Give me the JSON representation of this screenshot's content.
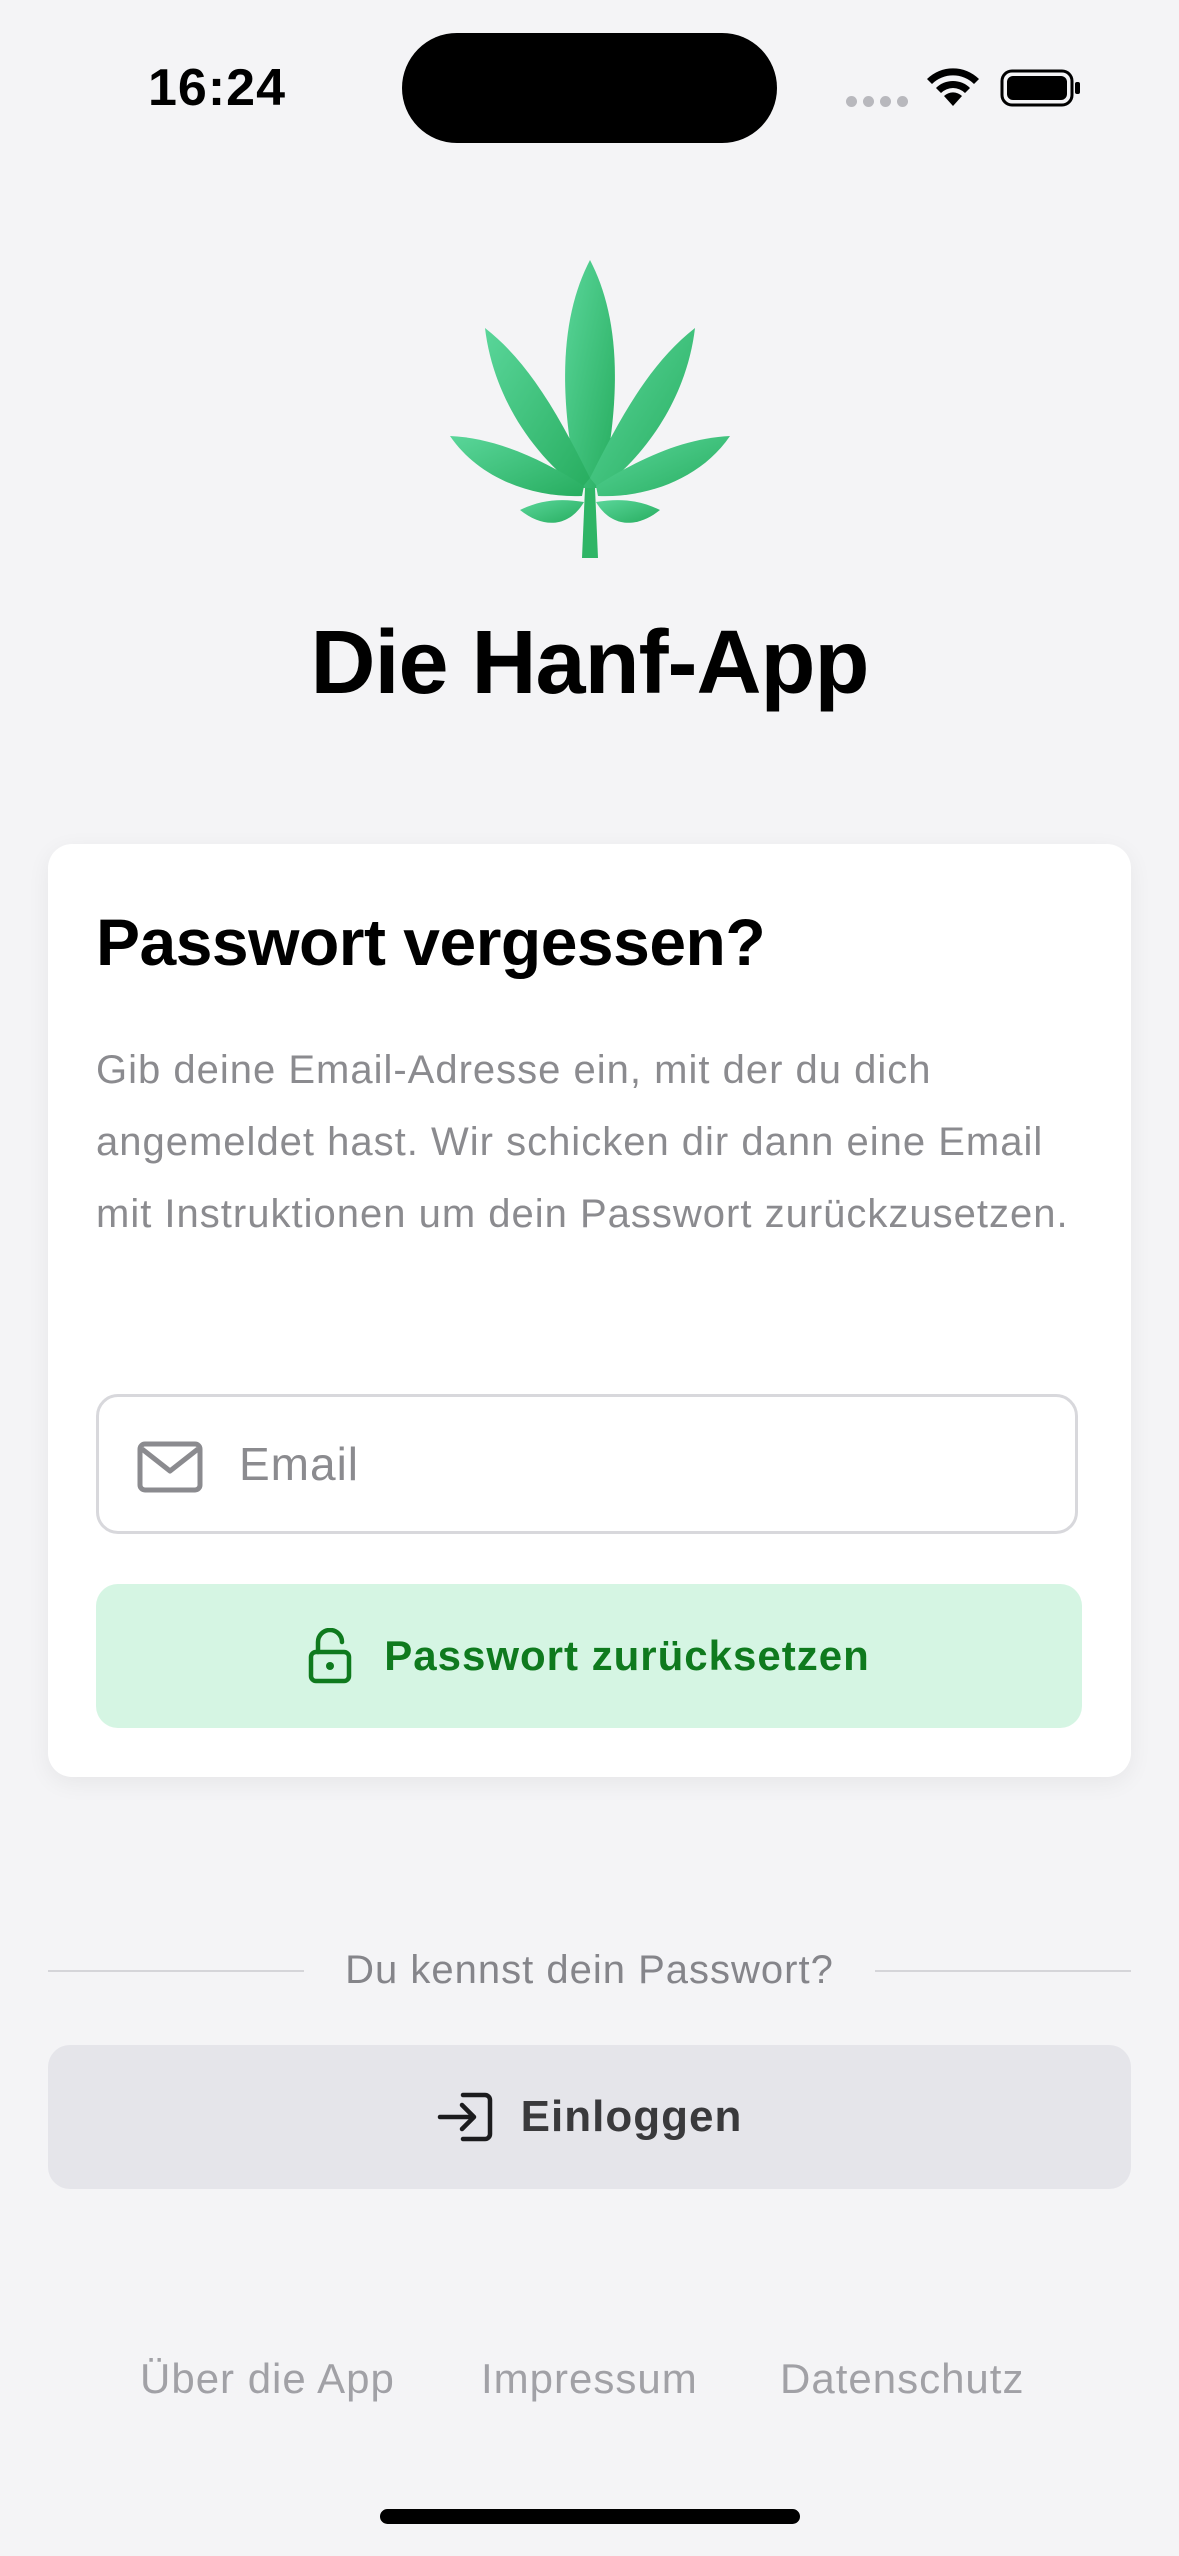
{
  "status_bar": {
    "time": "16:24"
  },
  "header": {
    "logo_icon": "hemp-leaf-icon",
    "app_title": "Die Hanf-App"
  },
  "card": {
    "title": "Passwort vergessen?",
    "description": "Gib deine Email-Adresse ein, mit der du dich angemeldet hast. Wir schicken dir dann eine Email mit Instruktionen um dein Passwort zurückzusetzen.",
    "email_field": {
      "icon": "mail-icon",
      "placeholder": "Email",
      "value": ""
    },
    "reset_button": {
      "icon": "lock-open-icon",
      "label": "Passwort zurücksetzen"
    }
  },
  "divider": {
    "text": "Du kennst dein Passwort?"
  },
  "login_button": {
    "icon": "login-arrow-icon",
    "label": "Einloggen"
  },
  "footer": {
    "links": [
      "Über die App",
      "Impressum",
      "Datenschutz"
    ]
  },
  "colors": {
    "background": "#f4f4f6",
    "accent_green": "#0f7a1e",
    "reset_button_bg": "#d5f5e3",
    "logo_green": "#3cc57a",
    "login_button_bg": "#e5e5ea"
  }
}
